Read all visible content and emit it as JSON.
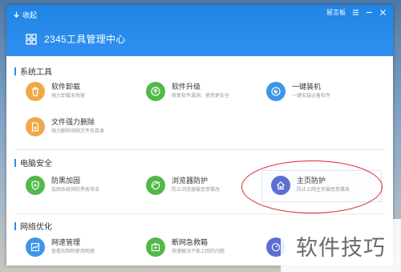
{
  "header": {
    "collapse_label": "收起",
    "feedback_label": "留言板",
    "title": "2345工具管理中心"
  },
  "sections": {
    "system": {
      "title": "系统工具",
      "tools": [
        {
          "name": "软件卸载",
          "desc": "强力卸载无残留",
          "color": "#f0a847",
          "icon": "trash-icon"
        },
        {
          "name": "软件升级",
          "desc": "修复软件漏洞，使用更安全",
          "color": "#52b84a",
          "icon": "upgrade-icon"
        },
        {
          "name": "一键装机",
          "desc": "一键安装必备软件",
          "color": "#3e96e8",
          "icon": "cursor-icon"
        },
        {
          "name": "文件强力删除",
          "desc": "强力删除顽固文件及目录",
          "color": "#f0a847",
          "icon": "file-delete-icon"
        }
      ]
    },
    "security": {
      "title": "电脑安全",
      "tools": [
        {
          "name": "防黑加固",
          "desc": "加固系统预防黑客攻击",
          "color": "#52b84a",
          "icon": "shield-icon"
        },
        {
          "name": "浏览器防护",
          "desc": "防止浏览器被恶意篡改",
          "color": "#52b84a",
          "icon": "browser-icon"
        },
        {
          "name": "主页防护",
          "desc": "防止上网主页被恶意篡改",
          "color": "#5b6fd0",
          "icon": "home-lock-icon"
        }
      ]
    },
    "network": {
      "title": "网络优化",
      "tools": [
        {
          "name": "网速管理",
          "desc": "查看和限制使用网速",
          "color": "#3e96e8",
          "icon": "speed-icon"
        },
        {
          "name": "断网急救箱",
          "desc": "快速解决不能上网的问题",
          "color": "#52b84a",
          "icon": "firstaid-icon"
        }
      ]
    }
  },
  "watermark": "软件技巧"
}
